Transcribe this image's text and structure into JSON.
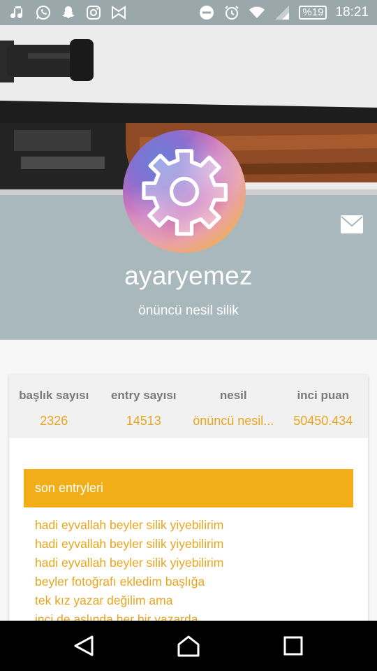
{
  "status_bar": {
    "battery": "%19",
    "time": "18:21",
    "left_icons": [
      "music-icon",
      "whatsapp-icon",
      "snapchat-icon",
      "instagram-icon",
      "bowtie-icon"
    ],
    "right_icons": [
      "do-not-disturb-icon",
      "alarm-icon",
      "wifi-icon",
      "signal-icon"
    ]
  },
  "profile": {
    "username": "ayaryemez",
    "title": "önüncü nesil silik"
  },
  "stats": [
    {
      "label": "başlık sayısı",
      "value": "2326"
    },
    {
      "label": "entry sayısı",
      "value": "14513"
    },
    {
      "label": "nesil",
      "value": "önüncü nesil..."
    },
    {
      "label": "inci puan",
      "value": "50450.434"
    }
  ],
  "recent": {
    "header": "son entryleri",
    "entries": [
      "hadi eyvallah beyler silik yiyebilirim",
      "hadi eyvallah beyler silik yiyebilirim",
      "hadi eyvallah beyler silik yiyebilirim",
      "beyler fotoğrafı ekledim başlığa",
      "tek kız yazar değilim ama",
      "inci de aslında her bir yazarda"
    ]
  },
  "colors": {
    "accent": "#f2ae18",
    "link": "#e8a51e",
    "panel": "#a9b8bc",
    "statusbar": "#9aa8ac"
  }
}
